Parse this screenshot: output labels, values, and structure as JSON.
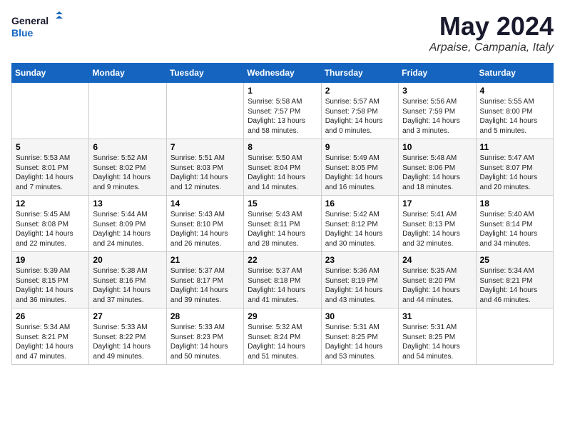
{
  "header": {
    "logo_line1": "General",
    "logo_line2": "Blue",
    "month": "May 2024",
    "location": "Arpaise, Campania, Italy"
  },
  "days_of_week": [
    "Sunday",
    "Monday",
    "Tuesday",
    "Wednesday",
    "Thursday",
    "Friday",
    "Saturday"
  ],
  "weeks": [
    [
      null,
      null,
      null,
      {
        "day": "1",
        "sunrise": "5:58 AM",
        "sunset": "7:57 PM",
        "daylight": "13 hours and 58 minutes."
      },
      {
        "day": "2",
        "sunrise": "5:57 AM",
        "sunset": "7:58 PM",
        "daylight": "14 hours and 0 minutes."
      },
      {
        "day": "3",
        "sunrise": "5:56 AM",
        "sunset": "7:59 PM",
        "daylight": "14 hours and 3 minutes."
      },
      {
        "day": "4",
        "sunrise": "5:55 AM",
        "sunset": "8:00 PM",
        "daylight": "14 hours and 5 minutes."
      }
    ],
    [
      {
        "day": "5",
        "sunrise": "5:53 AM",
        "sunset": "8:01 PM",
        "daylight": "14 hours and 7 minutes."
      },
      {
        "day": "6",
        "sunrise": "5:52 AM",
        "sunset": "8:02 PM",
        "daylight": "14 hours and 9 minutes."
      },
      {
        "day": "7",
        "sunrise": "5:51 AM",
        "sunset": "8:03 PM",
        "daylight": "14 hours and 12 minutes."
      },
      {
        "day": "8",
        "sunrise": "5:50 AM",
        "sunset": "8:04 PM",
        "daylight": "14 hours and 14 minutes."
      },
      {
        "day": "9",
        "sunrise": "5:49 AM",
        "sunset": "8:05 PM",
        "daylight": "14 hours and 16 minutes."
      },
      {
        "day": "10",
        "sunrise": "5:48 AM",
        "sunset": "8:06 PM",
        "daylight": "14 hours and 18 minutes."
      },
      {
        "day": "11",
        "sunrise": "5:47 AM",
        "sunset": "8:07 PM",
        "daylight": "14 hours and 20 minutes."
      }
    ],
    [
      {
        "day": "12",
        "sunrise": "5:45 AM",
        "sunset": "8:08 PM",
        "daylight": "14 hours and 22 minutes."
      },
      {
        "day": "13",
        "sunrise": "5:44 AM",
        "sunset": "8:09 PM",
        "daylight": "14 hours and 24 minutes."
      },
      {
        "day": "14",
        "sunrise": "5:43 AM",
        "sunset": "8:10 PM",
        "daylight": "14 hours and 26 minutes."
      },
      {
        "day": "15",
        "sunrise": "5:43 AM",
        "sunset": "8:11 PM",
        "daylight": "14 hours and 28 minutes."
      },
      {
        "day": "16",
        "sunrise": "5:42 AM",
        "sunset": "8:12 PM",
        "daylight": "14 hours and 30 minutes."
      },
      {
        "day": "17",
        "sunrise": "5:41 AM",
        "sunset": "8:13 PM",
        "daylight": "14 hours and 32 minutes."
      },
      {
        "day": "18",
        "sunrise": "5:40 AM",
        "sunset": "8:14 PM",
        "daylight": "14 hours and 34 minutes."
      }
    ],
    [
      {
        "day": "19",
        "sunrise": "5:39 AM",
        "sunset": "8:15 PM",
        "daylight": "14 hours and 36 minutes."
      },
      {
        "day": "20",
        "sunrise": "5:38 AM",
        "sunset": "8:16 PM",
        "daylight": "14 hours and 37 minutes."
      },
      {
        "day": "21",
        "sunrise": "5:37 AM",
        "sunset": "8:17 PM",
        "daylight": "14 hours and 39 minutes."
      },
      {
        "day": "22",
        "sunrise": "5:37 AM",
        "sunset": "8:18 PM",
        "daylight": "14 hours and 41 minutes."
      },
      {
        "day": "23",
        "sunrise": "5:36 AM",
        "sunset": "8:19 PM",
        "daylight": "14 hours and 43 minutes."
      },
      {
        "day": "24",
        "sunrise": "5:35 AM",
        "sunset": "8:20 PM",
        "daylight": "14 hours and 44 minutes."
      },
      {
        "day": "25",
        "sunrise": "5:34 AM",
        "sunset": "8:21 PM",
        "daylight": "14 hours and 46 minutes."
      }
    ],
    [
      {
        "day": "26",
        "sunrise": "5:34 AM",
        "sunset": "8:21 PM",
        "daylight": "14 hours and 47 minutes."
      },
      {
        "day": "27",
        "sunrise": "5:33 AM",
        "sunset": "8:22 PM",
        "daylight": "14 hours and 49 minutes."
      },
      {
        "day": "28",
        "sunrise": "5:33 AM",
        "sunset": "8:23 PM",
        "daylight": "14 hours and 50 minutes."
      },
      {
        "day": "29",
        "sunrise": "5:32 AM",
        "sunset": "8:24 PM",
        "daylight": "14 hours and 51 minutes."
      },
      {
        "day": "30",
        "sunrise": "5:31 AM",
        "sunset": "8:25 PM",
        "daylight": "14 hours and 53 minutes."
      },
      {
        "day": "31",
        "sunrise": "5:31 AM",
        "sunset": "8:25 PM",
        "daylight": "14 hours and 54 minutes."
      },
      null
    ]
  ],
  "labels": {
    "sunrise": "Sunrise: ",
    "sunset": "Sunset: ",
    "daylight": "Daylight: "
  }
}
